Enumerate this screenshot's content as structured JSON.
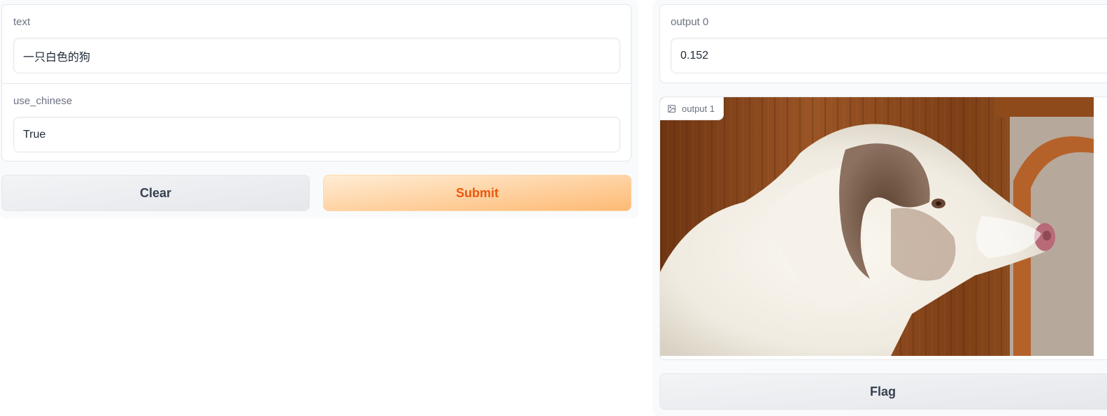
{
  "inputs": {
    "text": {
      "label": "text",
      "value": "一只白色的狗"
    },
    "use_chinese": {
      "label": "use_chinese",
      "value": "True"
    }
  },
  "actions": {
    "clear_label": "Clear",
    "submit_label": "Submit",
    "flag_label": "Flag"
  },
  "outputs": {
    "output_0": {
      "label": "output 0",
      "value": "0.152"
    },
    "output_1": {
      "label": "output 1",
      "image_icon": "image-icon"
    }
  },
  "colors": {
    "submit_text": "#ea580c",
    "submit_bg_start": "#ffedd5",
    "submit_bg_end": "#fdba74",
    "border": "#e5e7eb",
    "label": "#6b7280"
  }
}
